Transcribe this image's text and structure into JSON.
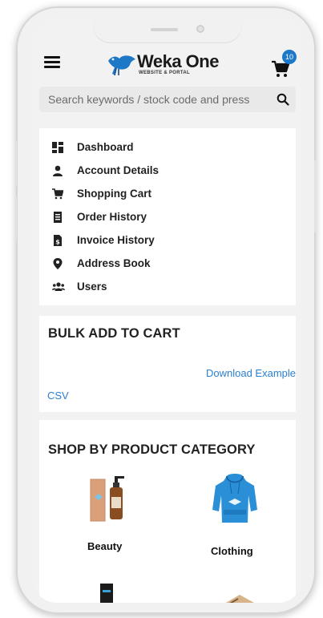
{
  "header": {
    "logo_title": "Weka One",
    "logo_subtitle": "WEBSITE & PORTAL",
    "cart_count": "10"
  },
  "search": {
    "placeholder": "Search keywords / stock code and press"
  },
  "menu": {
    "items": [
      {
        "label": "Dashboard",
        "icon": "dashboard-icon"
      },
      {
        "label": "Account Details",
        "icon": "user-icon"
      },
      {
        "label": "Shopping Cart",
        "icon": "cart-icon"
      },
      {
        "label": "Order History",
        "icon": "clipboard-icon"
      },
      {
        "label": "Invoice History",
        "icon": "invoice-icon"
      },
      {
        "label": "Address Book",
        "icon": "map-pin-icon"
      },
      {
        "label": "Users",
        "icon": "users-icon"
      }
    ]
  },
  "bulk": {
    "title": "BULK ADD TO CART",
    "download_link_part1": "Download Example",
    "download_link_part2": "CSV"
  },
  "shop": {
    "title": "SHOP BY PRODUCT CATEGORY",
    "categories": [
      {
        "label": "Beauty"
      },
      {
        "label": "Clothing"
      }
    ]
  },
  "colors": {
    "accent": "#1d78c7",
    "link": "#2b7fd0"
  }
}
